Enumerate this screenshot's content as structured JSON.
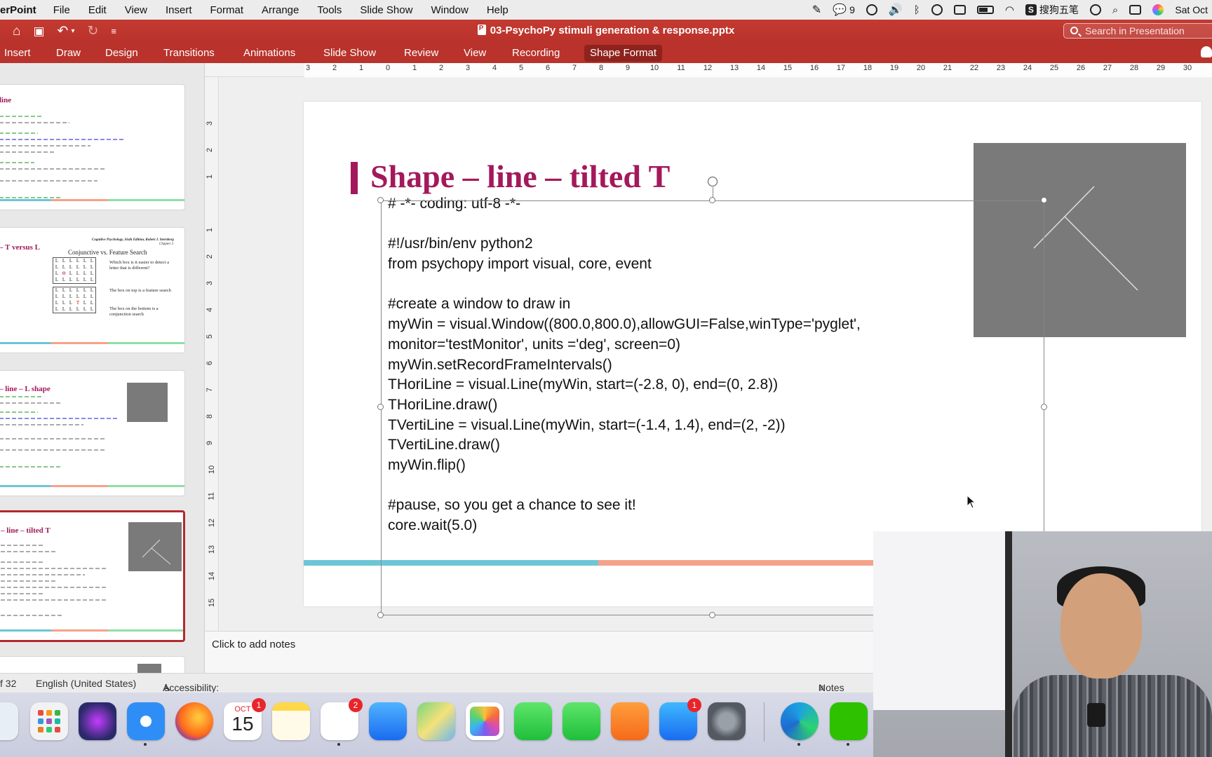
{
  "menubar": {
    "app_name": "erPoint",
    "items": [
      "File",
      "Edit",
      "View",
      "Insert",
      "Format",
      "Arrange",
      "Tools",
      "Slide Show",
      "Window",
      "Help"
    ],
    "wechat_count": "9",
    "input_method": "搜狗五笔",
    "datetime": "Sat Oct"
  },
  "titlebar": {
    "document_title": "03-PsychoPy stimuli generation & response.pptx",
    "search_placeholder": "Search in Presentation"
  },
  "ribbon": {
    "tabs": [
      "Insert",
      "Draw",
      "Design",
      "Transitions",
      "Animations",
      "Slide Show",
      "Review",
      "View",
      "Recording",
      "Shape Format"
    ],
    "active_tab": "Shape Format"
  },
  "ruler": {
    "horizontal": [
      "3",
      "2",
      "1",
      "0",
      "1",
      "2",
      "3",
      "4",
      "5",
      "6",
      "7",
      "8",
      "9",
      "10",
      "11",
      "12",
      "13",
      "14",
      "15",
      "16",
      "17",
      "18",
      "19",
      "20",
      "21",
      "22",
      "23",
      "24",
      "25",
      "26",
      "27",
      "28",
      "29",
      "30"
    ],
    "vertical": [
      "3",
      "2",
      "1",
      "1",
      "2",
      "3",
      "4",
      "5",
      "6",
      "7",
      "8",
      "9",
      "10",
      "11",
      "12",
      "13",
      "14",
      "15"
    ]
  },
  "thumbnails": [
    {
      "title": "line"
    },
    {
      "title": "– T versus L",
      "inner_title": "Conjunctive vs. Feature Search",
      "header_note": "Cognitive Psychology, Sixth Edition, Robert J. Sternberg",
      "chapter": "Chapter 3",
      "q1": "Which box is it easier to detect a letter that is different?",
      "q2": "The box on top is a feature search",
      "q3": "The box on the bottom is a conjunction search"
    },
    {
      "title": "– line – L shape"
    },
    {
      "title": "– line – tilted T"
    }
  ],
  "slide": {
    "title": "Shape – line – tilted T",
    "code_lines": [
      "# -*- coding: utf-8 -*-",
      "",
      "#!/usr/bin/env python2",
      "from psychopy import visual, core, event",
      "",
      "#create a window to draw in",
      "myWin = visual.Window((800.0,800.0),allowGUI=False,winType='pyglet',",
      "monitor='testMonitor', units ='deg', screen=0)",
      "myWin.setRecordFrameIntervals()",
      "THoriLine = visual.Line(myWin, start=(-2.8, 0), end=(0, 2.8))",
      "THoriLine.draw()",
      "TVertiLine = visual.Line(myWin, start=(-1.4, 1.4), end=(2, -2))",
      "TVertiLine.draw()",
      "myWin.flip()",
      "",
      "#pause, so you get a chance to see it!",
      "core.wait(5.0)"
    ]
  },
  "notes": {
    "placeholder": "Click to add notes"
  },
  "statusbar": {
    "slide_count": "f 32",
    "language": "English (United States)",
    "accessibility": "Accessibility: Investigate",
    "notes_button": "Notes",
    "zoom_fragment": "1"
  },
  "dock": {
    "calendar_month": "OCT",
    "calendar_day": "15",
    "badges": {
      "calendar": "1",
      "reminders": "2",
      "appstore": "1"
    }
  },
  "colors": {
    "ppt_red": "#c43a31",
    "title_magenta": "#a3195b",
    "bar_teal": "#6cc6d6",
    "bar_salmon": "#f4a28a",
    "bar_green": "#8ee0a8"
  }
}
